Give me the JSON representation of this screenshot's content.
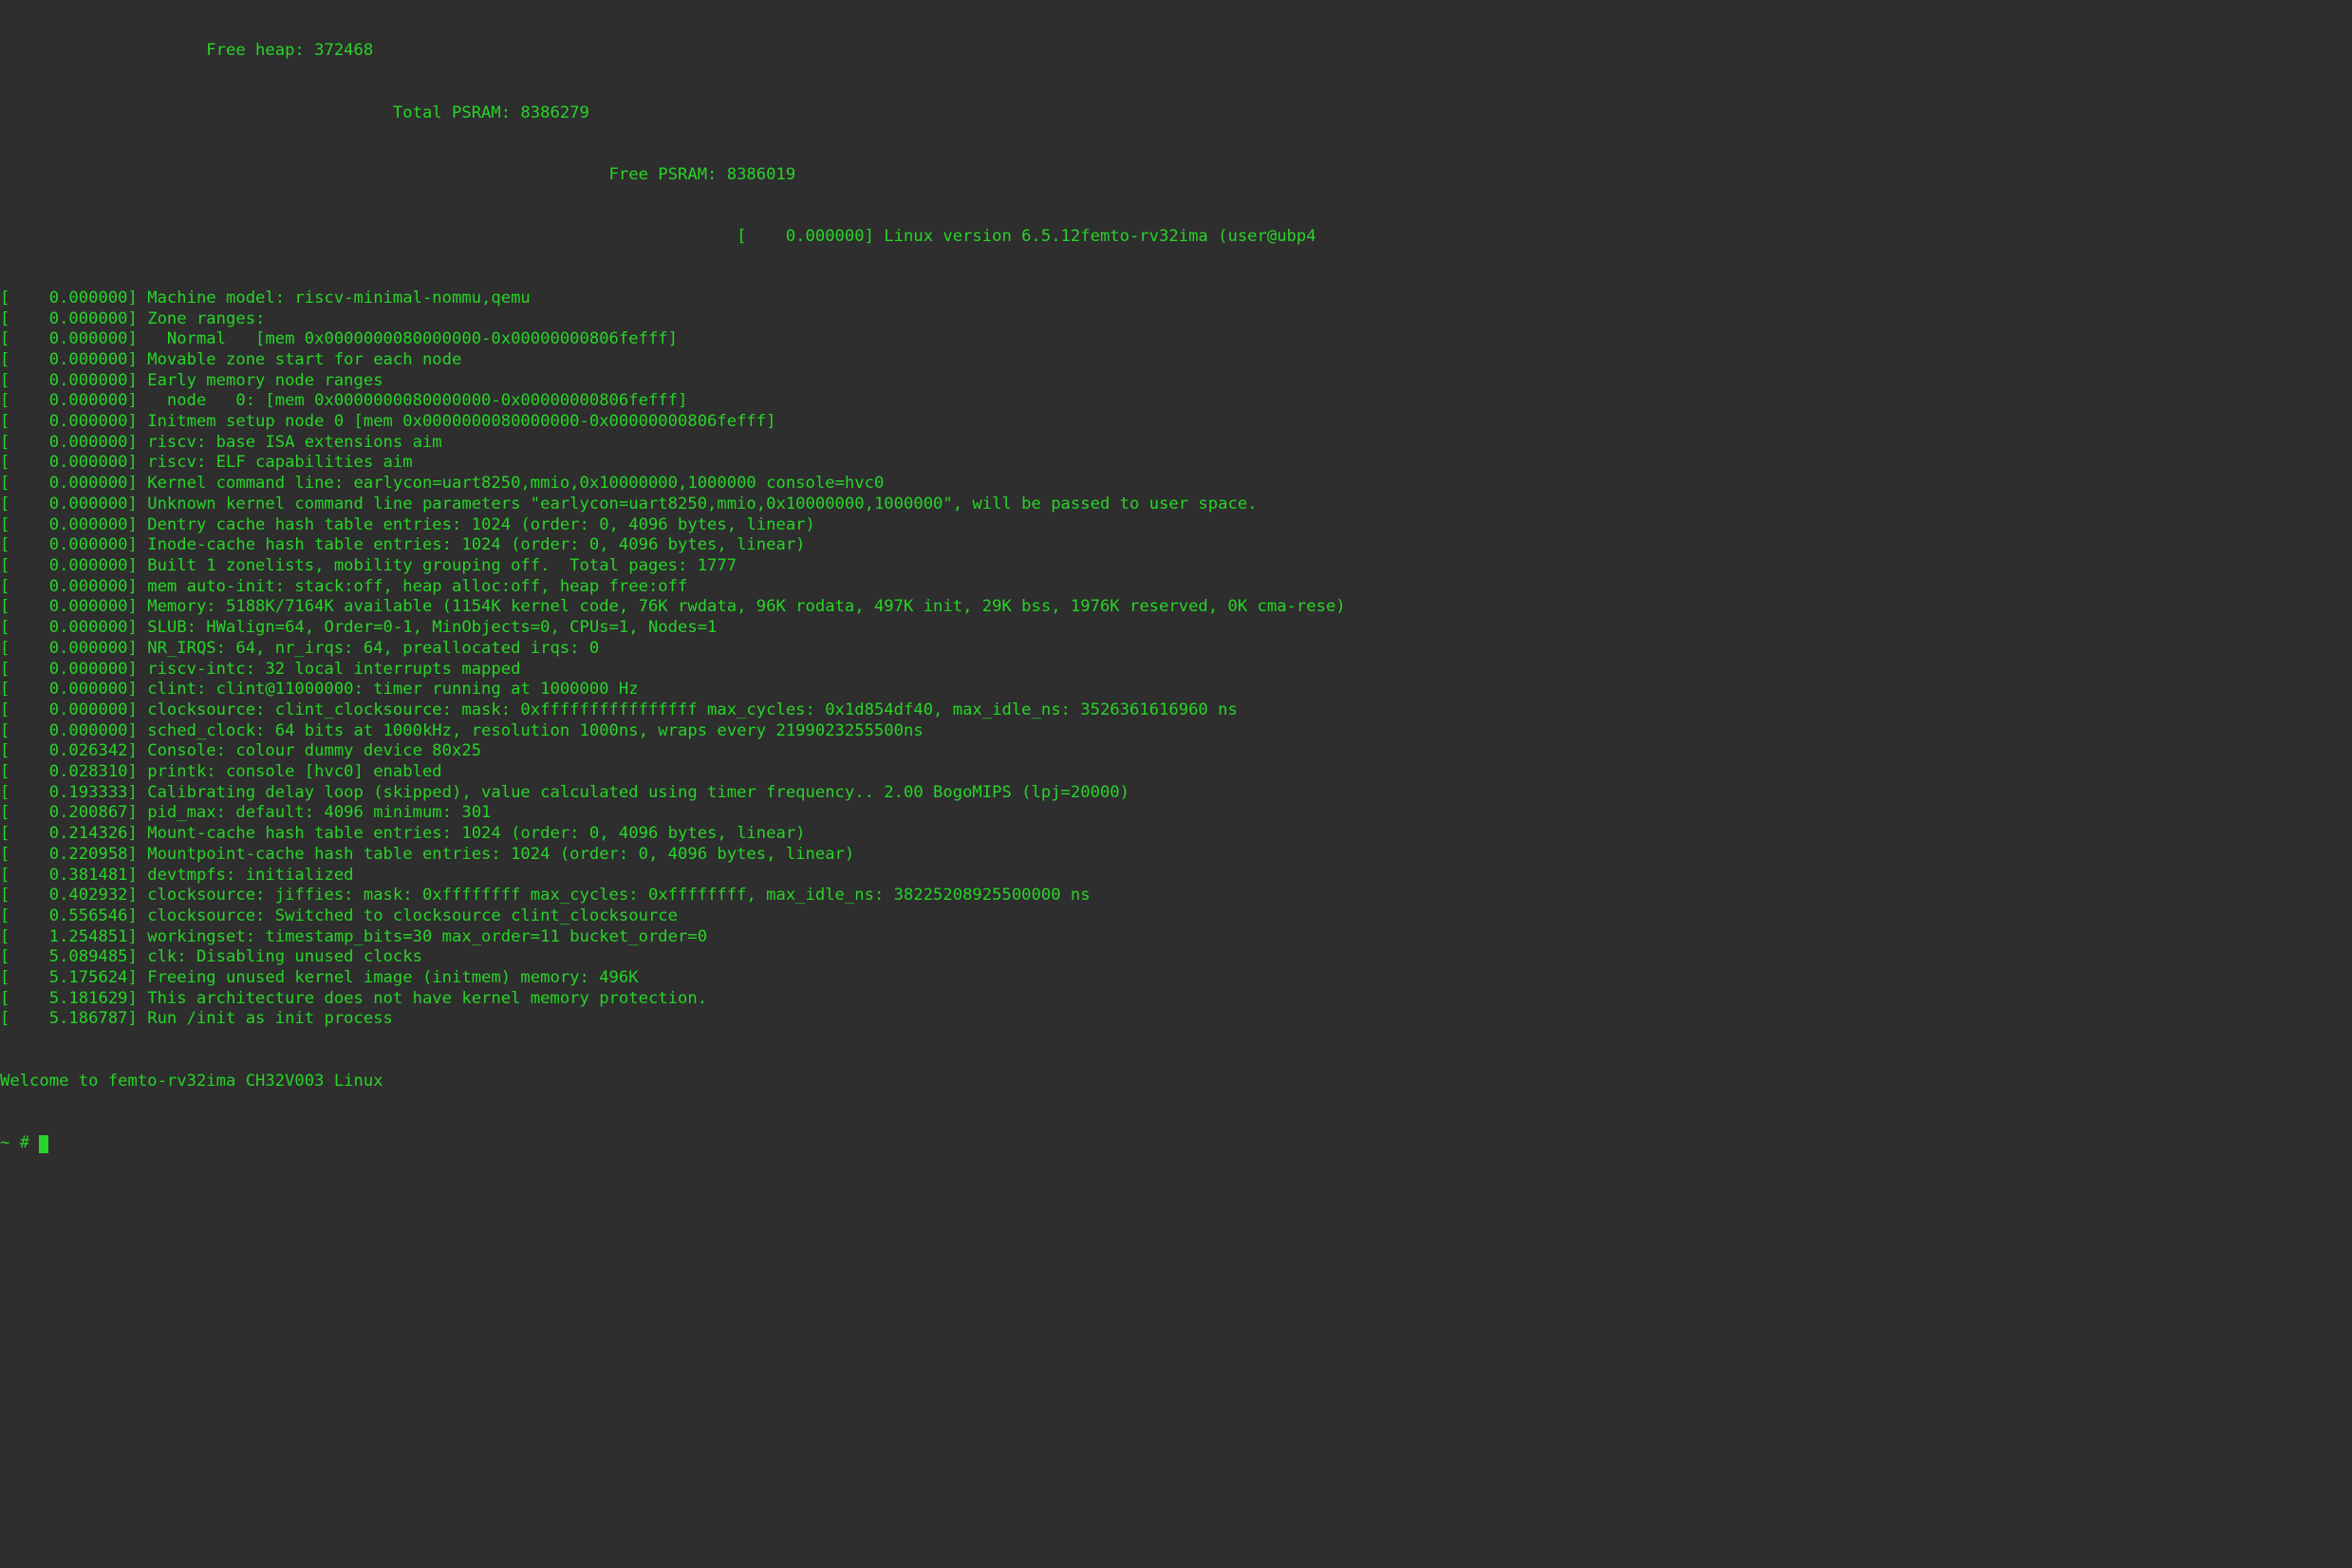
{
  "header": {
    "free_heap": "                     Free heap: 372468",
    "total_psram": "                                        Total PSRAM: 8386279",
    "free_psram": "                                                              Free PSRAM: 8386019",
    "version": "                                                                           [    0.000000] Linux version 6.5.12femto-rv32ima (user@ubp4"
  },
  "dmesg": [
    {
      "t": "0.000000",
      "m": "Machine model: riscv-minimal-nommu,qemu"
    },
    {
      "t": "0.000000",
      "m": "Zone ranges:"
    },
    {
      "t": "0.000000",
      "m": "  Normal   [mem 0x0000000080000000-0x00000000806fefff]"
    },
    {
      "t": "0.000000",
      "m": "Movable zone start for each node"
    },
    {
      "t": "0.000000",
      "m": "Early memory node ranges"
    },
    {
      "t": "0.000000",
      "m": "  node   0: [mem 0x0000000080000000-0x00000000806fefff]"
    },
    {
      "t": "0.000000",
      "m": "Initmem setup node 0 [mem 0x0000000080000000-0x00000000806fefff]"
    },
    {
      "t": "0.000000",
      "m": "riscv: base ISA extensions aim"
    },
    {
      "t": "0.000000",
      "m": "riscv: ELF capabilities aim"
    },
    {
      "t": "0.000000",
      "m": "Kernel command line: earlycon=uart8250,mmio,0x10000000,1000000 console=hvc0"
    },
    {
      "t": "0.000000",
      "m": "Unknown kernel command line parameters \"earlycon=uart8250,mmio,0x10000000,1000000\", will be passed to user space."
    },
    {
      "t": "0.000000",
      "m": "Dentry cache hash table entries: 1024 (order: 0, 4096 bytes, linear)"
    },
    {
      "t": "0.000000",
      "m": "Inode-cache hash table entries: 1024 (order: 0, 4096 bytes, linear)"
    },
    {
      "t": "0.000000",
      "m": "Built 1 zonelists, mobility grouping off.  Total pages: 1777"
    },
    {
      "t": "0.000000",
      "m": "mem auto-init: stack:off, heap alloc:off, heap free:off"
    },
    {
      "t": "0.000000",
      "m": "Memory: 5188K/7164K available (1154K kernel code, 76K rwdata, 96K rodata, 497K init, 29K bss, 1976K reserved, 0K cma-rese)"
    },
    {
      "t": "0.000000",
      "m": "SLUB: HWalign=64, Order=0-1, MinObjects=0, CPUs=1, Nodes=1"
    },
    {
      "t": "0.000000",
      "m": "NR_IRQS: 64, nr_irqs: 64, preallocated irqs: 0"
    },
    {
      "t": "0.000000",
      "m": "riscv-intc: 32 local interrupts mapped"
    },
    {
      "t": "0.000000",
      "m": "clint: clint@11000000: timer running at 1000000 Hz"
    },
    {
      "t": "0.000000",
      "m": "clocksource: clint_clocksource: mask: 0xffffffffffffffff max_cycles: 0x1d854df40, max_idle_ns: 3526361616960 ns"
    },
    {
      "t": "0.000000",
      "m": "sched_clock: 64 bits at 1000kHz, resolution 1000ns, wraps every 2199023255500ns"
    },
    {
      "t": "0.026342",
      "m": "Console: colour dummy device 80x25"
    },
    {
      "t": "0.028310",
      "m": "printk: console [hvc0] enabled"
    },
    {
      "t": "0.193333",
      "m": "Calibrating delay loop (skipped), value calculated using timer frequency.. 2.00 BogoMIPS (lpj=20000)"
    },
    {
      "t": "0.200867",
      "m": "pid_max: default: 4096 minimum: 301"
    },
    {
      "t": "0.214326",
      "m": "Mount-cache hash table entries: 1024 (order: 0, 4096 bytes, linear)"
    },
    {
      "t": "0.220958",
      "m": "Mountpoint-cache hash table entries: 1024 (order: 0, 4096 bytes, linear)"
    },
    {
      "t": "0.381481",
      "m": "devtmpfs: initialized"
    },
    {
      "t": "0.402932",
      "m": "clocksource: jiffies: mask: 0xffffffff max_cycles: 0xffffffff, max_idle_ns: 38225208925500000 ns"
    },
    {
      "t": "0.556546",
      "m": "clocksource: Switched to clocksource clint_clocksource"
    },
    {
      "t": "1.254851",
      "m": "workingset: timestamp_bits=30 max_order=11 bucket_order=0"
    },
    {
      "t": "5.089485",
      "m": "clk: Disabling unused clocks"
    },
    {
      "t": "5.175624",
      "m": "Freeing unused kernel image (initmem) memory: 496K"
    },
    {
      "t": "5.181629",
      "m": "This architecture does not have kernel memory protection."
    },
    {
      "t": "5.186787",
      "m": "Run /init as init process"
    }
  ],
  "footer": {
    "welcome": "Welcome to femto-rv32ima CH32V003 Linux",
    "prompt": "~ # "
  }
}
